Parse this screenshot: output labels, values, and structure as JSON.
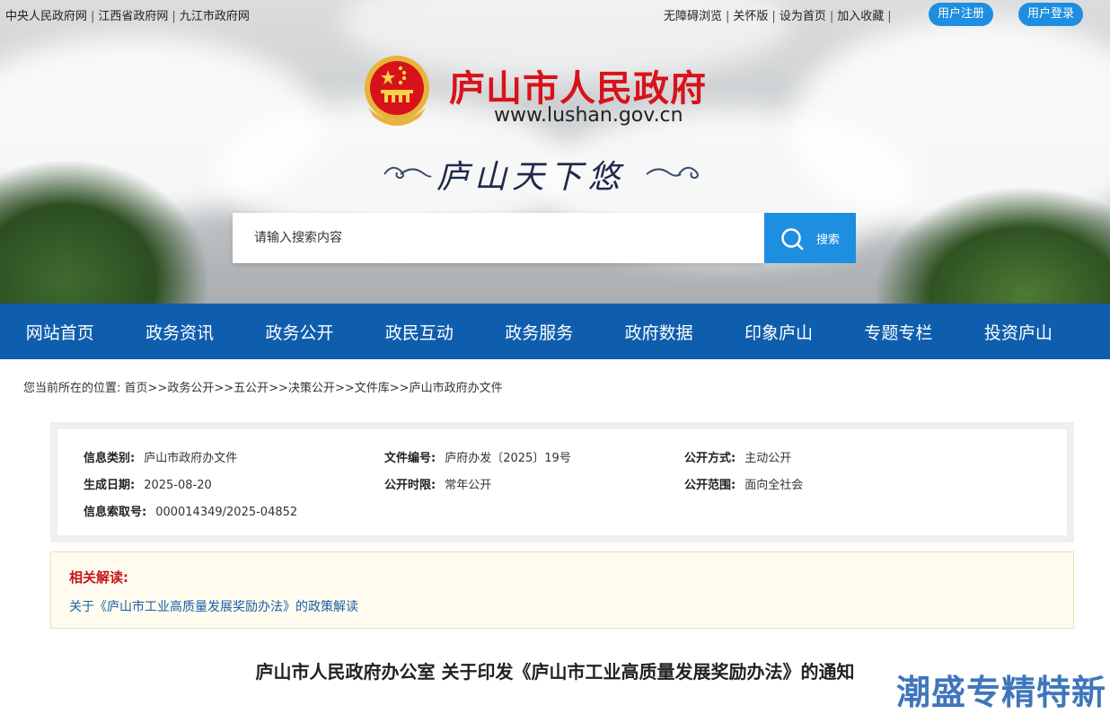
{
  "top_links": {
    "left": [
      "中央人民政府网",
      "江西省政府网",
      "九江市政府网"
    ],
    "accessible": "无障碍浏览",
    "care": "关怀版",
    "set_home": "设为首页",
    "favorite": "加入收藏",
    "register": "用户注册",
    "login": "用户登录"
  },
  "header": {
    "title": "庐山市人民政府",
    "url": "www.lushan.gov.cn",
    "slogan": "庐山天下悠"
  },
  "search": {
    "placeholder": "请输入搜索内容",
    "button": "搜索"
  },
  "nav": [
    "网站首页",
    "政务资讯",
    "政务公开",
    "政民互动",
    "政务服务",
    "政府数据",
    "印象庐山",
    "专题专栏",
    "投资庐山"
  ],
  "breadcrumb": {
    "prefix": "您当前所在的位置: ",
    "items": [
      "首页",
      "政务公开",
      "五公开",
      "决策公开",
      "文件库",
      "庐山市政府办文件"
    ],
    "sep": ">>"
  },
  "info": {
    "category_label": "信息类别:",
    "category": "庐山市政府办文件",
    "doc_no_label": "文件编号:",
    "doc_no": "庐府办发〔2025〕19号",
    "mode_label": "公开方式:",
    "mode": "主动公开",
    "date_label": "生成日期:",
    "date": "2025-08-20",
    "period_label": "公开时限:",
    "period": "常年公开",
    "scope_label": "公开范围:",
    "scope": "面向全社会",
    "index_label": "信息索取号:",
    "index": "000014349/2025-04852"
  },
  "related": {
    "title": "相关解读:",
    "link": "关于《庐山市工业高质量发展奖励办法》的政策解读"
  },
  "article": {
    "title": "庐山市人民政府办公室 关于印发《庐山市工业高质量发展奖励办法》的通知"
  },
  "watermark": "潮盛专精特新",
  "colors": {
    "brand_red": "#d8121a",
    "nav_blue": "#0f5eae",
    "accent_blue": "#1e8ee0"
  }
}
